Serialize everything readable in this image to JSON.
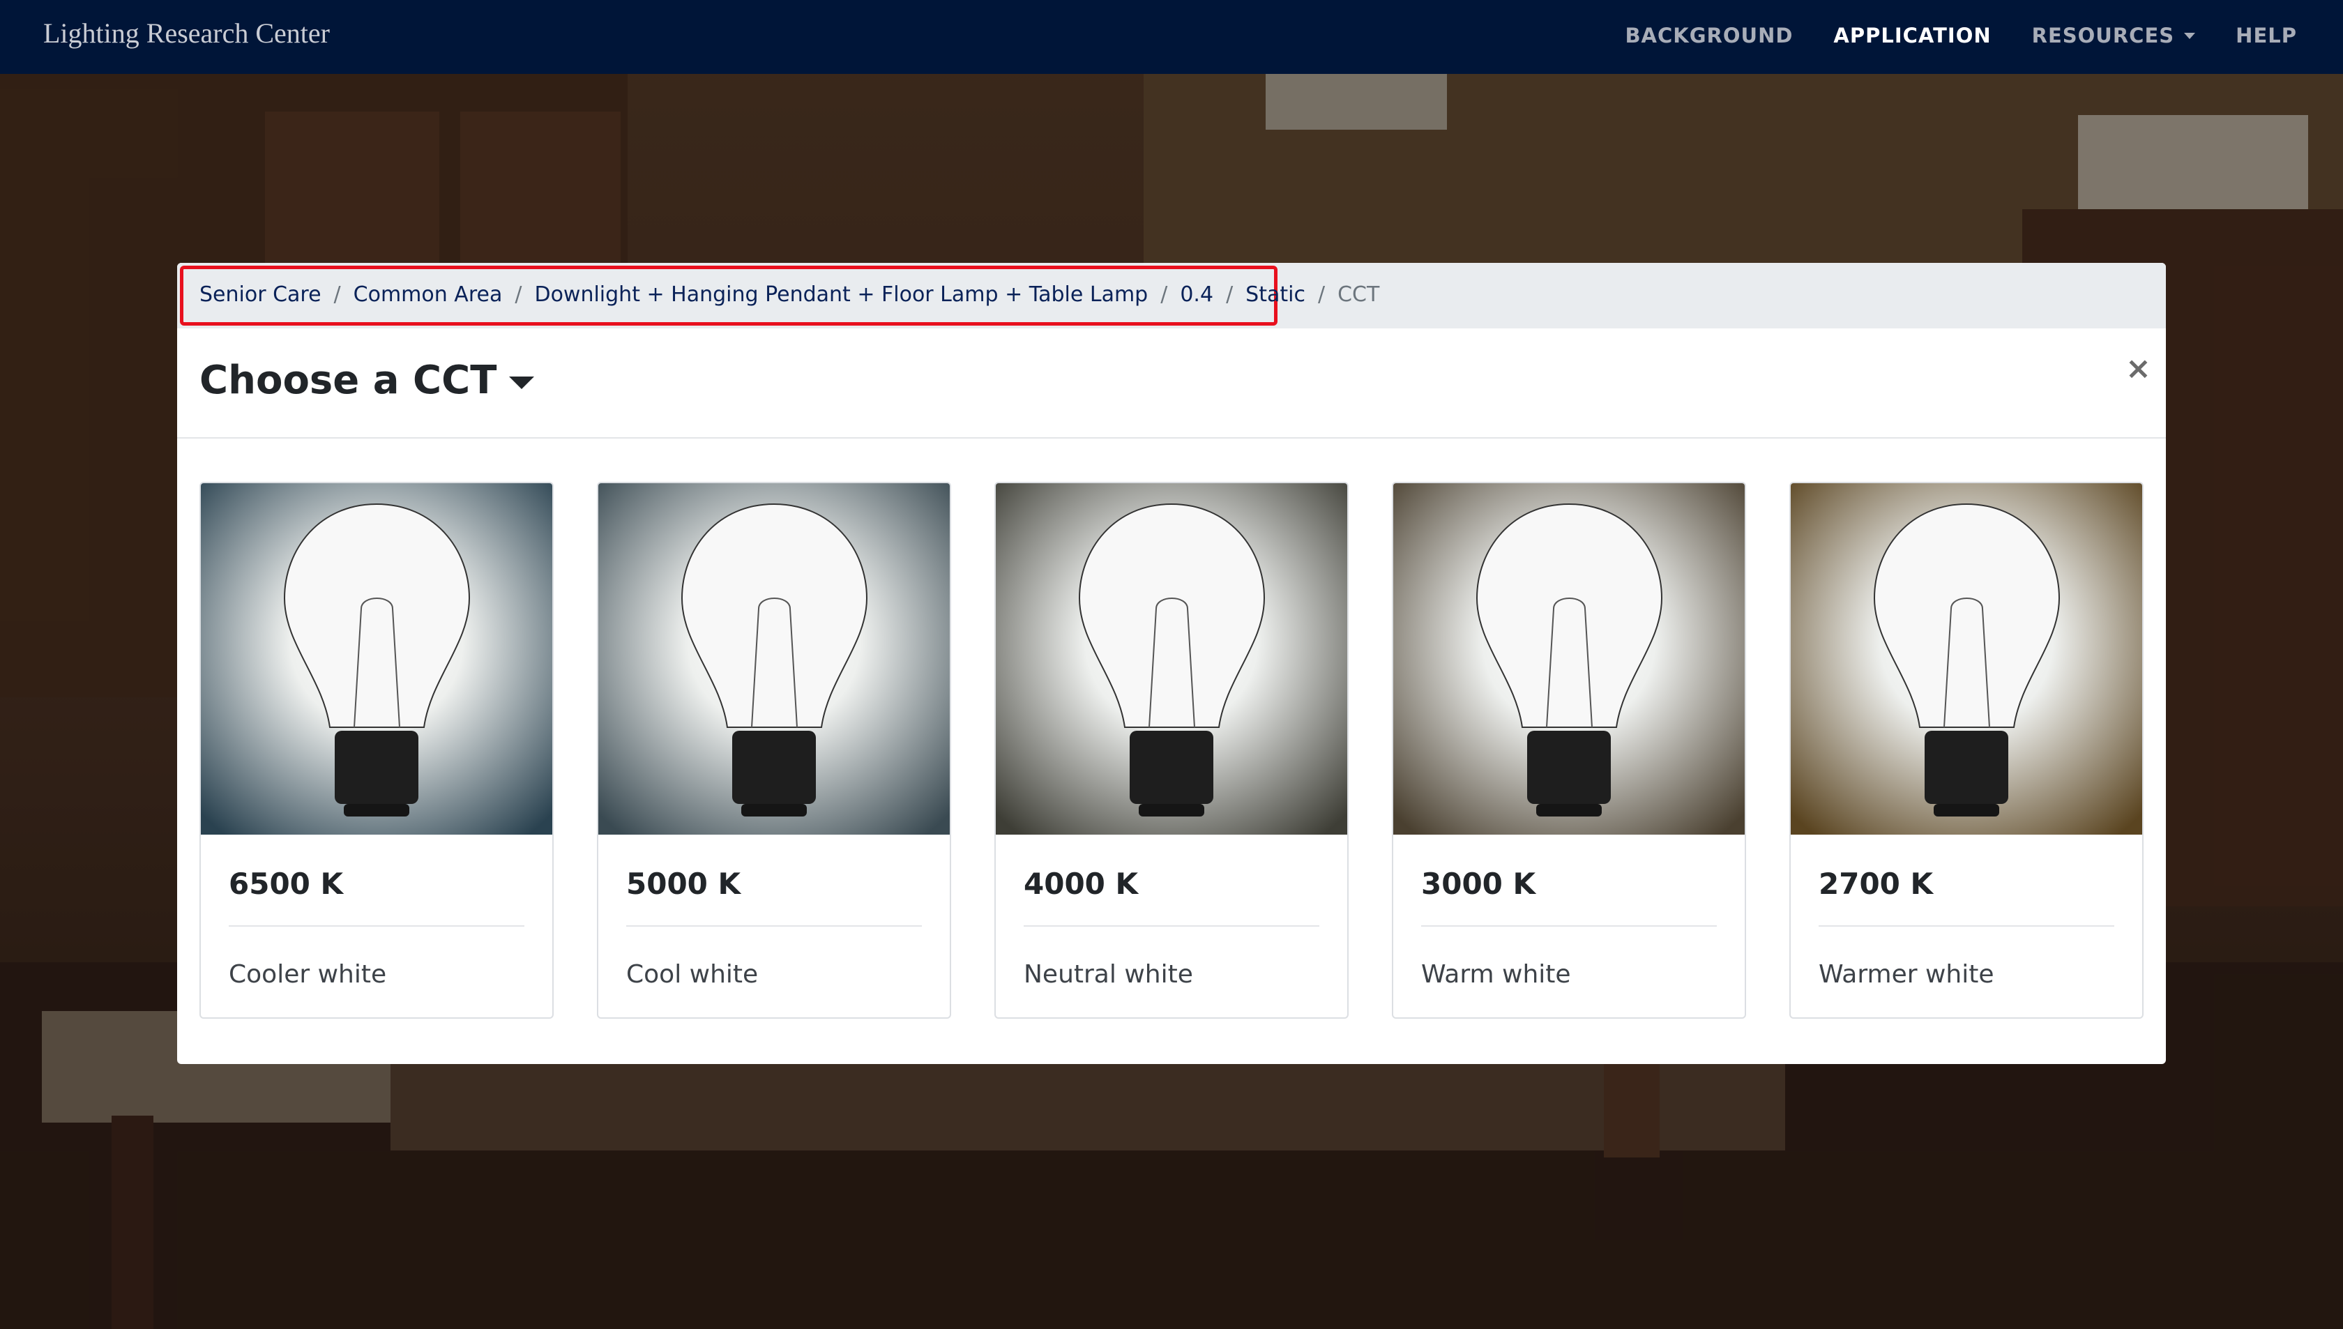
{
  "navbar": {
    "brand": "Lighting Research Center",
    "links": [
      {
        "label": "BACKGROUND"
      },
      {
        "label": "APPLICATION"
      },
      {
        "label": "RESOURCES"
      },
      {
        "label": "HELP"
      }
    ]
  },
  "modal": {
    "breadcrumb": [
      "Senior Care",
      "Common Area",
      "Downlight + Hanging Pendant + Floor Lamp + Table Lamp",
      "0.4",
      "Static",
      "CCT"
    ],
    "breadcrumb_separator": "/",
    "title": "Choose a CCT",
    "close_label": "×",
    "cards": [
      {
        "value": "6500 K",
        "label": "Cooler white",
        "tint": "#2a4250"
      },
      {
        "value": "5000 K",
        "label": "Cool white",
        "tint": "#3a4a52"
      },
      {
        "value": "4000 K",
        "label": "Neutral white",
        "tint": "#3e3e36"
      },
      {
        "value": "3000 K",
        "label": "Warm white",
        "tint": "#4a4030"
      },
      {
        "value": "2700 K",
        "label": "Warmer white",
        "tint": "#5a4420"
      }
    ]
  },
  "colors": {
    "navbar": "#001538",
    "highlight": "#e8101e",
    "breadcrumb_link": "#0a2258"
  }
}
